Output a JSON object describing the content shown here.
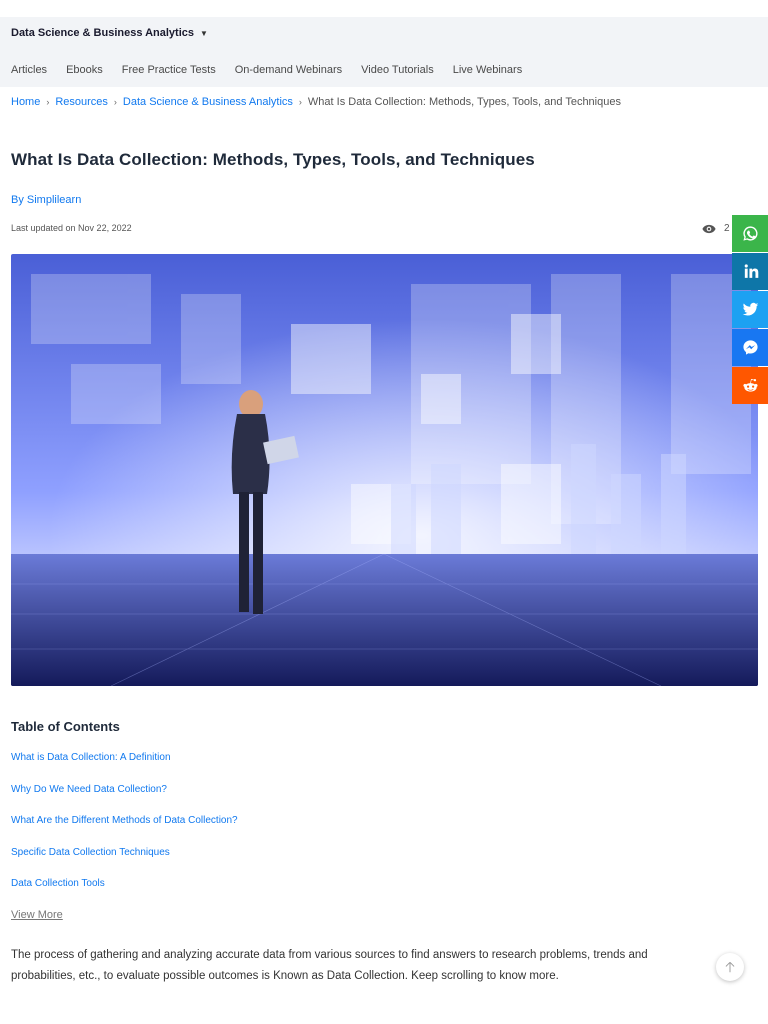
{
  "category": {
    "title": "Data Science & Business Analytics"
  },
  "subnav": [
    "Articles",
    "Ebooks",
    "Free Practice Tests",
    "On-demand Webinars",
    "Video Tutorials",
    "Live Webinars"
  ],
  "breadcrumb": [
    "Home",
    "Resources",
    "Data Science & Business Analytics",
    "What Is Data Collection: Methods, Types, Tools, and Techniques"
  ],
  "article": {
    "title": "What Is Data Collection: Methods, Types, Tools, and Techniques",
    "byline_prefix": "By",
    "author": "Simplilearn",
    "updated": "Last updated on Nov 22, 2022",
    "views": "2"
  },
  "toc": {
    "title": "Table of Contents",
    "items": [
      "What is Data Collection: A Definition",
      "Why Do We Need Data Collection?",
      "What Are the Different Methods of Data Collection?",
      "Specific Data Collection Techniques",
      "Data Collection Tools"
    ],
    "view_more": "View More"
  },
  "intro": "The process of gathering and analyzing accurate data from various sources to find answers to research problems, trends and probabilities, etc., to evaluate possible outcomes is Known as Data Collection. Keep scrolling to know more.",
  "share": [
    "whatsapp-icon",
    "linkedin-icon",
    "twitter-icon",
    "messenger-icon",
    "reddit-icon"
  ],
  "colors": {
    "link": "#1179ef",
    "whatsapp": "#3bb54a",
    "linkedin": "#0e76a8",
    "twitter": "#1da1f2",
    "messenger": "#1877f2",
    "reddit": "#ff5700"
  }
}
